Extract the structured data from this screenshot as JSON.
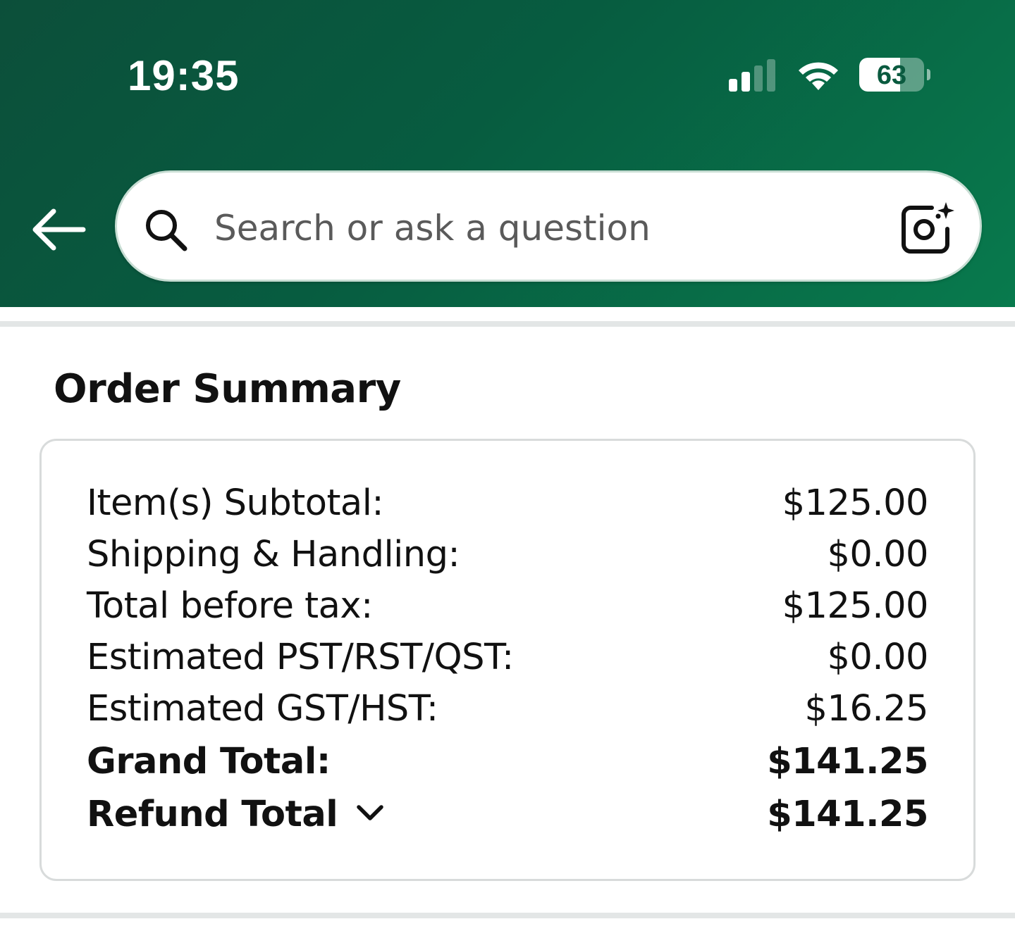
{
  "status_bar": {
    "time": "19:35",
    "battery_percent": 63,
    "battery_label": "63",
    "signal_bars_active": 2,
    "signal_bars_total": 4
  },
  "header": {
    "back_icon": "arrow-left-icon",
    "search": {
      "placeholder": "Search or ask a question",
      "value": "",
      "search_icon": "search-icon",
      "camera_icon": "camera-sparkle-icon"
    }
  },
  "order_summary": {
    "title": "Order Summary",
    "rows": [
      {
        "label": "Item(s) Subtotal:",
        "value": "$125.00"
      },
      {
        "label": "Shipping & Handling:",
        "value": "$0.00"
      },
      {
        "label": "Total before tax:",
        "value": "$125.00"
      },
      {
        "label": "Estimated PST/RST/QST:",
        "value": "$0.00"
      },
      {
        "label": "Estimated GST/HST:",
        "value": "$16.25"
      },
      {
        "label": "Grand Total:",
        "value": "$141.25"
      },
      {
        "label": "Refund Total",
        "value": "$141.25"
      }
    ],
    "refund_icon": "chevron-down-icon"
  },
  "colors": {
    "header_gradient_start": "#0c4f3a",
    "header_gradient_end": "#087a4d",
    "divider": "#e3e6e6",
    "card_border": "#d8dbdb"
  }
}
